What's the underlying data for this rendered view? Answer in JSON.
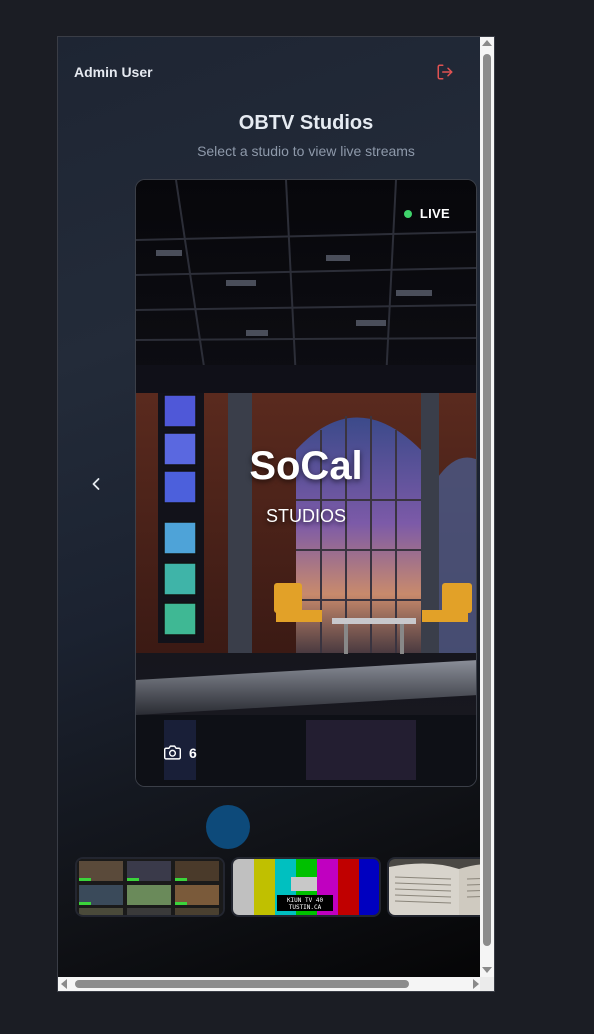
{
  "header": {
    "user_name": "Admin User",
    "logout_icon": "logout-icon"
  },
  "page": {
    "title": "OBTV Studios",
    "subtitle": "Select a studio to view live streams"
  },
  "featured_studio": {
    "name": "SoCal",
    "tagline": "STUDIOS",
    "live_label": "LIVE",
    "camera_count": "6",
    "camera_icon": "camera-icon",
    "live_color": "#3fd36b"
  },
  "carousel": {
    "prev_icon": "chevron-left-icon",
    "active_indicator_color": "#0d4a7a"
  },
  "thumbnails": [
    {
      "name": "multiview-grid"
    },
    {
      "name": "color-bars",
      "caption_line1": "KIUN TV 40",
      "caption_line2": "TUSTIN.CA"
    },
    {
      "name": "open-book"
    }
  ],
  "colors": {
    "accent_logout": "#e05252",
    "background": "#1b1d24"
  }
}
